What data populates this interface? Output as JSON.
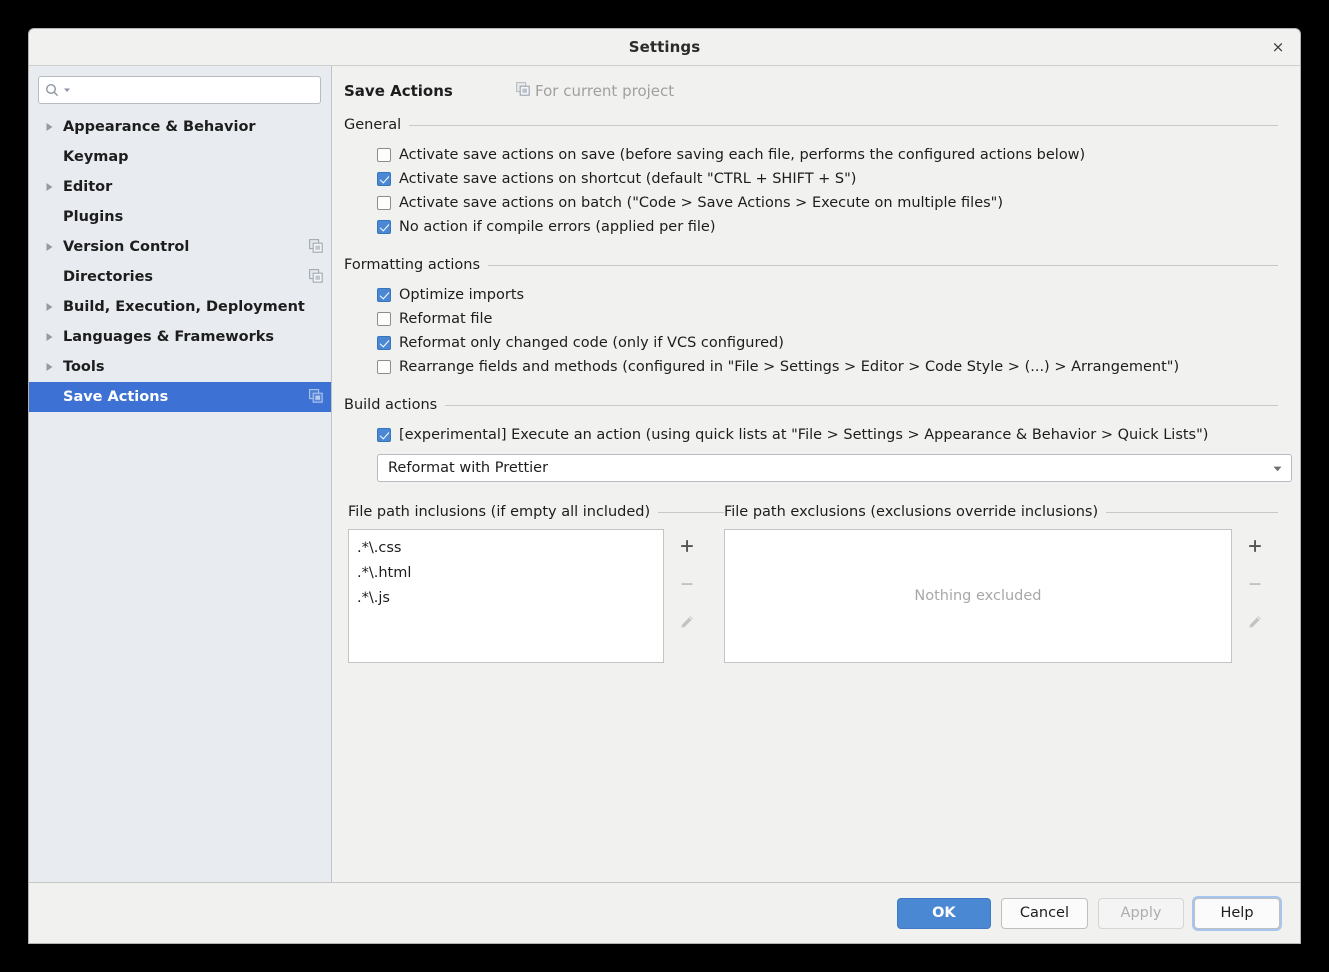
{
  "window": {
    "title": "Settings",
    "close_label": "×"
  },
  "sidebar": {
    "search": {
      "value": "",
      "placeholder": ""
    },
    "items": [
      {
        "label": "Appearance & Behavior",
        "expandable": true,
        "project_icon": false,
        "selected": false
      },
      {
        "label": "Keymap",
        "expandable": false,
        "project_icon": false,
        "selected": false
      },
      {
        "label": "Editor",
        "expandable": true,
        "project_icon": false,
        "selected": false
      },
      {
        "label": "Plugins",
        "expandable": false,
        "project_icon": false,
        "selected": false
      },
      {
        "label": "Version Control",
        "expandable": true,
        "project_icon": true,
        "selected": false
      },
      {
        "label": "Directories",
        "expandable": false,
        "project_icon": true,
        "selected": false
      },
      {
        "label": "Build, Execution, Deployment",
        "expandable": true,
        "project_icon": false,
        "selected": false
      },
      {
        "label": "Languages & Frameworks",
        "expandable": true,
        "project_icon": false,
        "selected": false
      },
      {
        "label": "Tools",
        "expandable": true,
        "project_icon": false,
        "selected": false
      },
      {
        "label": "Save Actions",
        "expandable": false,
        "project_icon": true,
        "selected": true
      }
    ]
  },
  "main": {
    "page_title": "Save Actions",
    "for_project_label": "For current project",
    "sections": {
      "general": {
        "title": "General",
        "options": [
          {
            "label": "Activate save actions on save (before saving each file, performs the configured actions below)",
            "checked": false
          },
          {
            "label": "Activate save actions on shortcut (default \"CTRL + SHIFT + S\")",
            "checked": true
          },
          {
            "label": "Activate save actions on batch (\"Code > Save Actions > Execute on multiple files\")",
            "checked": false
          },
          {
            "label": "No action if compile errors (applied per file)",
            "checked": true
          }
        ]
      },
      "formatting": {
        "title": "Formatting actions",
        "options": [
          {
            "label": "Optimize imports",
            "checked": true
          },
          {
            "label": "Reformat file",
            "checked": false
          },
          {
            "label": "Reformat only changed code (only if VCS configured)",
            "checked": true
          },
          {
            "label": "Rearrange fields and methods (configured in \"File > Settings > Editor > Code Style > (...) > Arrangement\")",
            "checked": false
          }
        ]
      },
      "build": {
        "title": "Build actions",
        "options": [
          {
            "label": "[experimental] Execute an action (using quick lists at \"File > Settings > Appearance & Behavior > Quick Lists\")",
            "checked": true
          }
        ],
        "action_combo": {
          "value": "Reformat with Prettier",
          "options": [
            "Reformat with Prettier"
          ]
        }
      },
      "inclusions": {
        "title": "File path inclusions (if empty all included)",
        "items": [
          ".*\\.css",
          ".*\\.html",
          ".*\\.js"
        ],
        "buttons": [
          {
            "name": "add",
            "glyph": "+",
            "enabled": true
          },
          {
            "name": "remove",
            "glyph": "−",
            "enabled": false
          },
          {
            "name": "edit",
            "glyph": "pencil",
            "enabled": false
          }
        ]
      },
      "exclusions": {
        "title": "File path exclusions (exclusions override inclusions)",
        "items": [],
        "empty_text": "Nothing excluded",
        "buttons": [
          {
            "name": "add",
            "glyph": "+",
            "enabled": true
          },
          {
            "name": "remove",
            "glyph": "−",
            "enabled": false
          },
          {
            "name": "edit",
            "glyph": "pencil",
            "enabled": false
          }
        ]
      }
    }
  },
  "footer": {
    "ok": "OK",
    "cancel": "Cancel",
    "apply": "Apply",
    "help": "Help"
  },
  "colors": {
    "accent_blue": "#3d72d4",
    "button_blue": "#4a88d4",
    "sidebar_bg": "#e8ecf0",
    "panel_bg": "#f1f1f0",
    "focus_ring": "#a7c6ef"
  }
}
